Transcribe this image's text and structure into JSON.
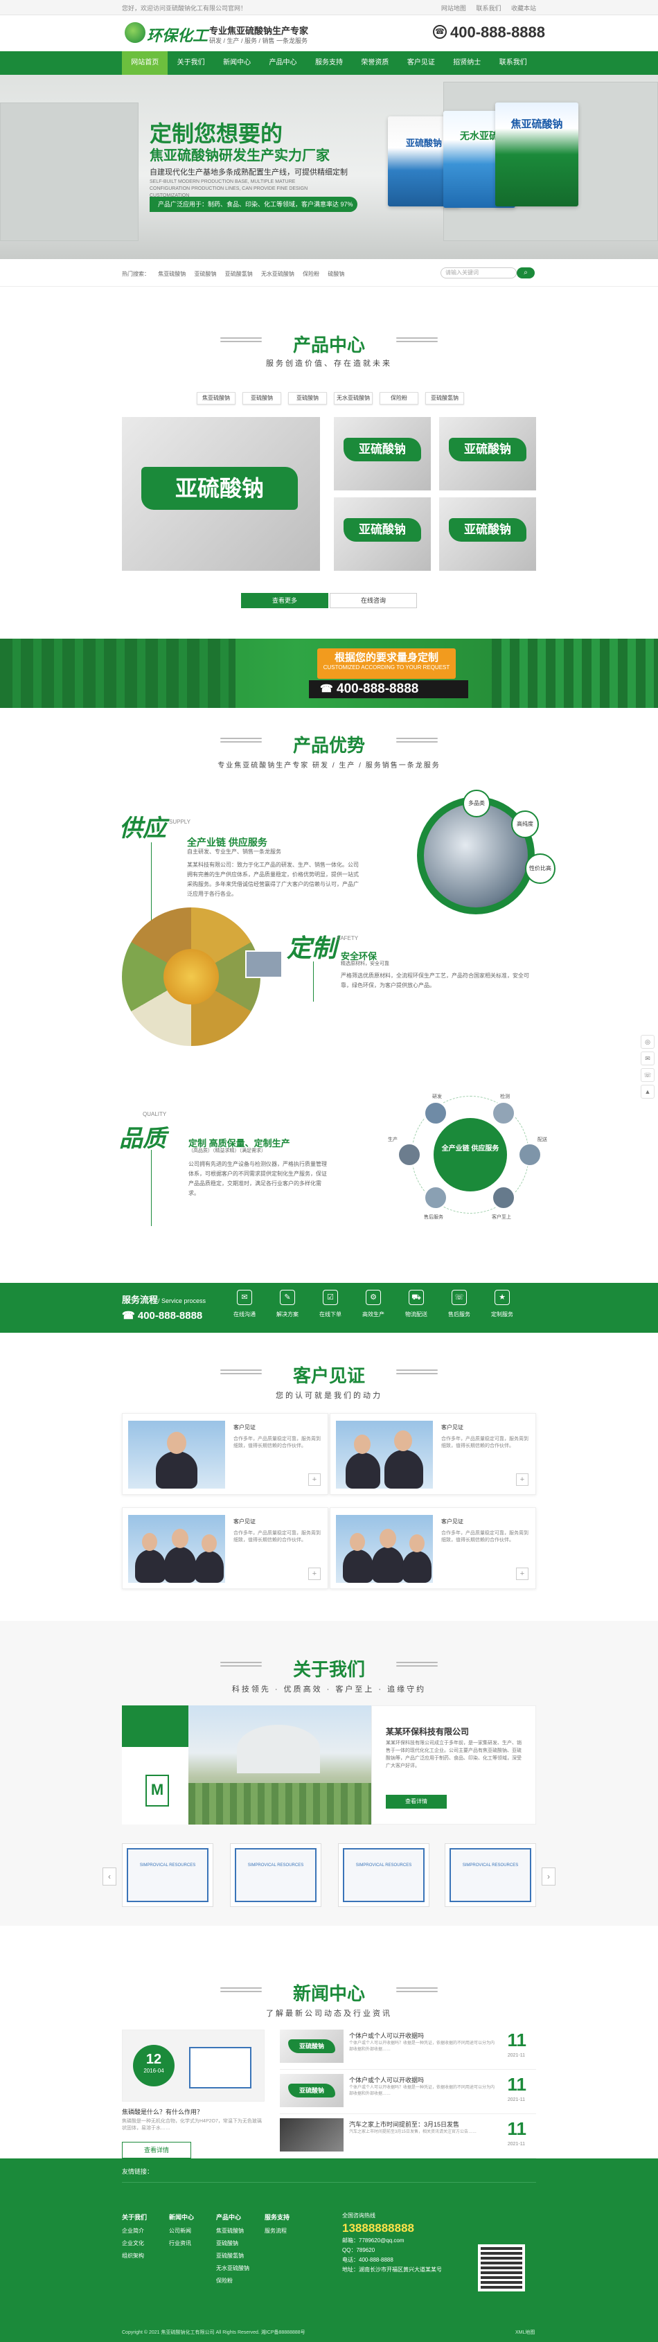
{
  "topbar": {
    "welcome": "您好，欢迎访问亚硫酸钠化工有限公司官网！",
    "links": [
      "网站地图",
      "联系我们",
      "收藏本站"
    ]
  },
  "header": {
    "logo": "环保化工",
    "slogan_main": "专业焦亚硫酸钠生产专家",
    "slogan_sub": "研发 / 生产 / 服务 / 销售 一条龙服务",
    "phone": "400-888-8888"
  },
  "nav": {
    "items": [
      "网站首页",
      "关于我们",
      "新闻中心",
      "产品中心",
      "服务支持",
      "荣誉资质",
      "客户见证",
      "招贤纳士",
      "联系我们"
    ]
  },
  "banner": {
    "h1": "定制您想要的",
    "h2": "焦亚硫酸钠研发生产实力厂家",
    "p1": "自建现代化生产基地多条成熟配置生产线，可提供精细定制",
    "p2": "SELF-BUILT MODERN PRODUCTION BASE, MULTIPLE MATURE CONFIGURATION PRODUCTION LINES, CAN PROVIDE FINE DESIGN CUSTOMIZATION",
    "tag": "产品广泛应用于：制药、食品、印染、化工等领域，客户满意率达 97%",
    "bag1": "亚硫酸钠",
    "bag2": "无水亚硫",
    "bag3": "焦亚硫酸钠"
  },
  "crumbs": {
    "items": [
      "热门搜索：",
      "焦亚硫酸钠",
      "亚硫酸钠",
      "亚硫酸氢钠",
      "无水亚硫酸钠",
      "保险粉",
      "硫酸钠"
    ],
    "search_placeholder": "请输入关键词",
    "search_icon": "search-icon"
  },
  "products": {
    "title": "产品中心",
    "subtitle": "服务创造价值、存在造就未来",
    "tabs": [
      "焦亚硫酸钠",
      "亚硫酸钠",
      "亚硫酸钠",
      "无水亚硫酸钠",
      "保险粉",
      "亚硫酸氢钠"
    ],
    "badge": "亚硫酸钠",
    "more": "查看更多",
    "consult": "在线咨询"
  },
  "custom": {
    "t1": "根据您的要求量身定制",
    "t2": "CUSTOMIZED ACCORDING TO YOUR REQUEST",
    "phone": "400-888-8888"
  },
  "advantages": {
    "title": "产品优势",
    "subtitle": "专业焦亚硫酸钠生产专家 研发 / 生产 / 服务销售一条龙服务",
    "a1": {
      "cal": "供应",
      "en": "SUPPLY",
      "h": "全产业链 供应服务",
      "s": "自主研发、专业生产、销售一条龙服务",
      "p": "某某科技有限公司：致力于化工产品的研发、生产、销售一体化。公司拥有完善的生产供应体系，产品质量稳定，价格优势明显，提供一站式采购服务。多年来凭借诚信经营赢得了广大客户的信赖与认可，产品广泛应用于各行各业。"
    },
    "a2": {
      "cal": "定制",
      "en": "SAFETY",
      "h": "安全环保",
      "s": "精选原材料，安全可靠",
      "p": "严格筛选优质原材料，全流程环保生产工艺，产品符合国家相关标准，安全可靠，绿色环保，为客户提供放心产品。"
    },
    "a3": {
      "cal": "品质",
      "en": "QUALITY",
      "h": "定制 高质保量、定制生产",
      "s": "（高品质）（精益求精）（满足需求）",
      "p": "公司拥有先进的生产设备与检测仪器，严格执行质量管理体系，可根据客户的不同需求提供定制化生产服务，保证产品品质稳定，交期准时，满足各行业客户的多样化需求。"
    },
    "circle1": [
      "多品类",
      "高纯度",
      "性价比高"
    ],
    "circle3_center": "全产业链 供应服务",
    "circle3_labels": [
      "研发",
      "检测",
      "生产",
      "配送",
      "售后服务",
      "客户至上"
    ]
  },
  "service": {
    "title": "服务流程",
    "title_en": "/ Service process",
    "phone": "400-888-8888",
    "steps": [
      "在线沟通",
      "解决方案",
      "在线下单",
      "高效生产",
      "物流配送",
      "售后服务",
      "定制服务"
    ]
  },
  "testimonials": {
    "title": "客户见证",
    "subtitle": "您的认可就是我们的动力",
    "items": [
      {
        "name": "客户见证",
        "text": "合作多年，产品质量稳定可靠，服务周到细致，值得长期信赖的合作伙伴。"
      },
      {
        "name": "客户见证",
        "text": "合作多年，产品质量稳定可靠，服务周到细致，值得长期信赖的合作伙伴。"
      },
      {
        "name": "客户见证",
        "text": "合作多年，产品质量稳定可靠，服务周到细致，值得长期信赖的合作伙伴。"
      },
      {
        "name": "客户见证",
        "text": "合作多年，产品质量稳定可靠，服务周到细致，值得长期信赖的合作伙伴。"
      }
    ]
  },
  "about": {
    "title": "关于我们",
    "subtitle": "科技领先 · 优质高效 · 客户至上 · 追缘守约",
    "company": "某某环保科技有限公司",
    "text": "某某环保科技有限公司成立于多年前，是一家集研发、生产、销售于一体的现代化化工企业。公司主要产品有焦亚硫酸钠、亚硫酸钠等，产品广泛应用于制药、食品、印染、化工等领域，深受广大客户好评。",
    "more": "查看详情",
    "letter": "M",
    "cert_text": "SIMPROVICAL RESOURCES"
  },
  "news": {
    "title": "新闻中心",
    "subtitle": "了解最新公司动态及行业资讯",
    "feature_day": "12",
    "feature_ym": "2016-04",
    "feature_title": "焦磷酸是什么？有什么作用？",
    "feature_text": "焦磷酸是一种无机化合物，化学式为H4P2O7，常温下为无色玻璃状固体，易溶于水……",
    "feature_btn": "查看详情",
    "items": [
      {
        "title": "个体户或个人可以开收据吗",
        "text": "个体户或个人可以开收据吗？收据是一种凭证，依据收据的不同用途可以分为内部收据和外部收据……",
        "day": "11",
        "ym": "2021-11"
      },
      {
        "title": "个体户或个人可以开收据吗",
        "text": "个体户或个人可以开收据吗？收据是一种凭证，依据收据的不同用途可以分为内部收据和外部收据……",
        "day": "11",
        "ym": "2021-11"
      },
      {
        "title": "汽车之家上市时间提前至：3月15日发售",
        "text": "汽车之家上市时间提前至3月15日发售，相关资讯请关注官方公告……",
        "day": "11",
        "ym": "2021-11"
      }
    ]
  },
  "footer": {
    "links_label": "友情链接：",
    "cols": [
      {
        "head": "关于我们",
        "items": [
          "企业简介",
          "企业文化",
          "组织架构"
        ]
      },
      {
        "head": "新闻中心",
        "items": [
          "公司新闻",
          "行业资讯"
        ]
      },
      {
        "head": "产品中心",
        "items": [
          "焦亚硫酸钠",
          "亚硫酸钠",
          "亚硫酸氢钠",
          "无水亚硫酸钠",
          "保险粉"
        ]
      },
      {
        "head": "服务支持",
        "items": [
          "服务流程"
        ]
      }
    ],
    "contact_label": "全国咨询热线",
    "contact_phone": "13888888888",
    "contact_lines": [
      "邮箱：7789620@qq.com",
      "QQ：789620",
      "电话：400-888-8888",
      "地址：湖南长沙市开福区黄兴大道某某号"
    ],
    "copyright": "Copyright © 2021 焦亚硫酸钠化工有限公司 All Rights Reserved.  湘ICP备88888888号",
    "right": "XML地图"
  },
  "colors": {
    "primary": "#1b8a3a",
    "accent": "#6cbf3e",
    "orange": "#f29b1e"
  }
}
